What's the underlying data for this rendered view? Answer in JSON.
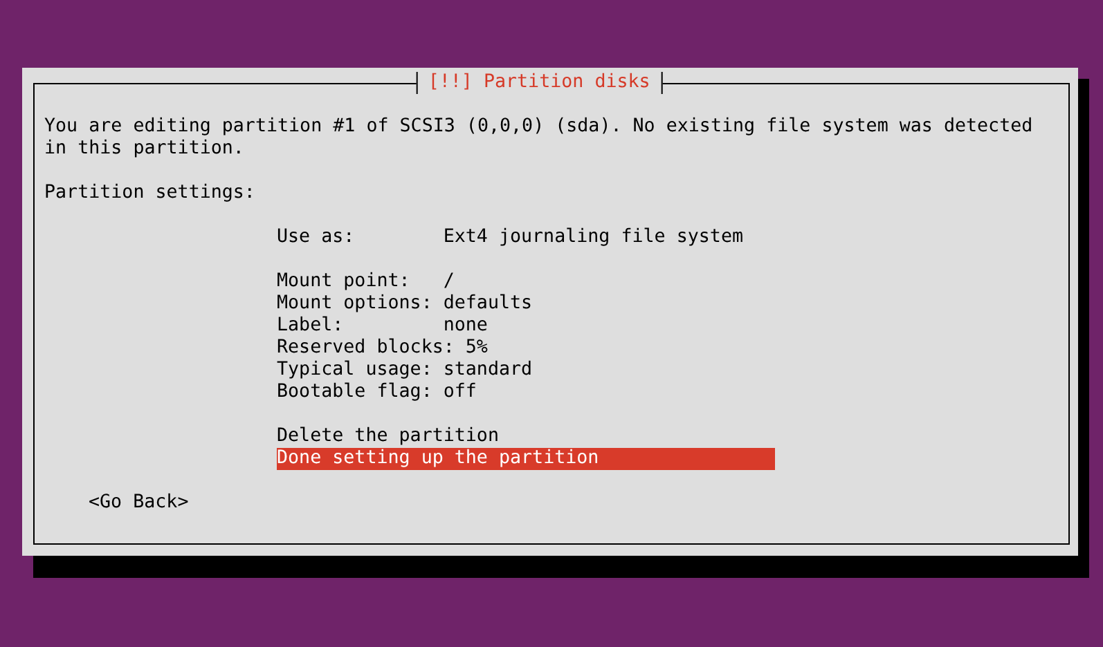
{
  "dialog": {
    "title": "[!!] Partition disks",
    "message": "You are editing partition #1 of SCSI3 (0,0,0) (sda). No existing file system was detected in this partition.",
    "section_label": "Partition settings:",
    "menu": [
      [
        {
          "label": "Use as:",
          "value": "Ext4 journaling file system",
          "selected": false
        }
      ],
      [
        {
          "label": "Mount point:",
          "value": "/",
          "selected": false
        },
        {
          "label": "Mount options:",
          "value": "defaults",
          "selected": false
        },
        {
          "label": "Label:",
          "value": "none",
          "selected": false
        },
        {
          "label": "Reserved blocks:",
          "value": "5%",
          "selected": false
        },
        {
          "label": "Typical usage:",
          "value": "standard",
          "selected": false
        },
        {
          "label": "Bootable flag:",
          "value": "off",
          "selected": false
        }
      ],
      [
        {
          "label": "Delete the partition",
          "selected": false
        },
        {
          "label": "Done setting up the partition",
          "selected": true
        }
      ]
    ],
    "back_button": "<Go Back>"
  }
}
